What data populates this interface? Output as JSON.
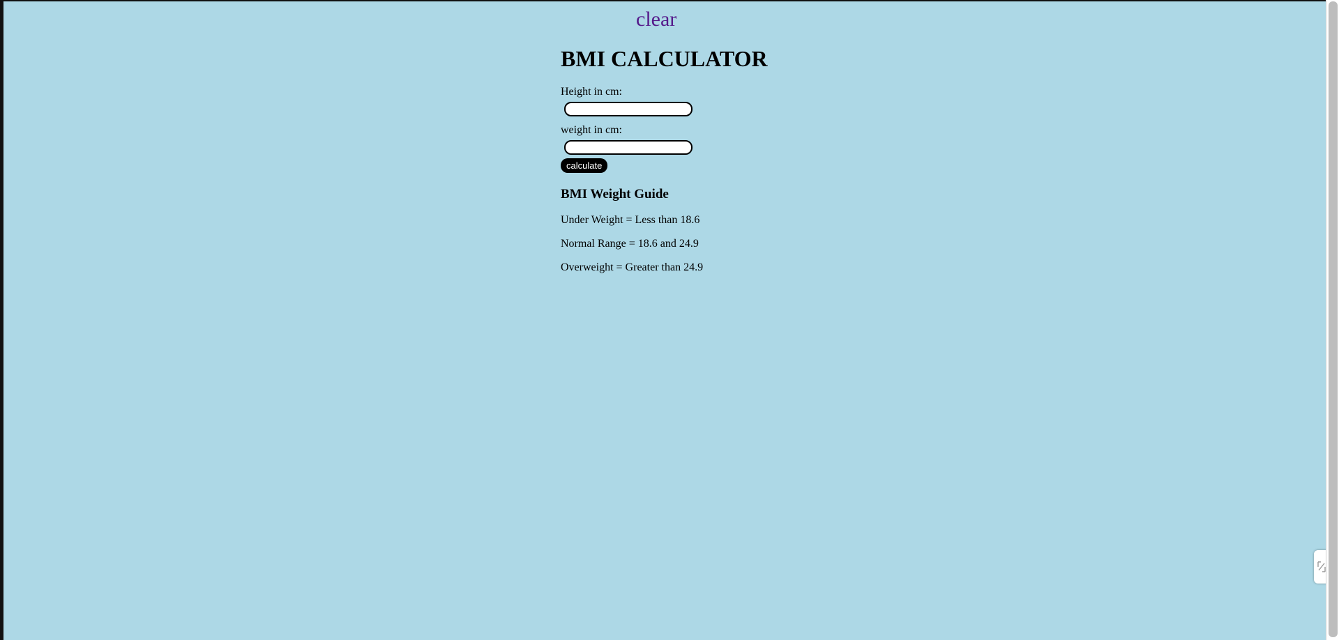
{
  "nav": {
    "clear_label": "clear"
  },
  "main": {
    "title": "BMI CALCULATOR",
    "height_label": "Height in cm:",
    "height_value": "",
    "weight_label": "weight in cm:",
    "weight_value": "",
    "calculate_label": "calculate"
  },
  "guide": {
    "title": "BMI Weight Guide",
    "lines": [
      "Under Weight = Less than 18.6",
      "Normal Range = 18.6 and 24.9",
      "Overweight = Greater than 24.9"
    ]
  },
  "colors": {
    "page_background": "#add8e6",
    "link_visited": "#551a8b",
    "button_background": "#000000",
    "button_text": "#ffffff"
  },
  "icons": {
    "side_widget": "collapse-arrows-icon"
  }
}
